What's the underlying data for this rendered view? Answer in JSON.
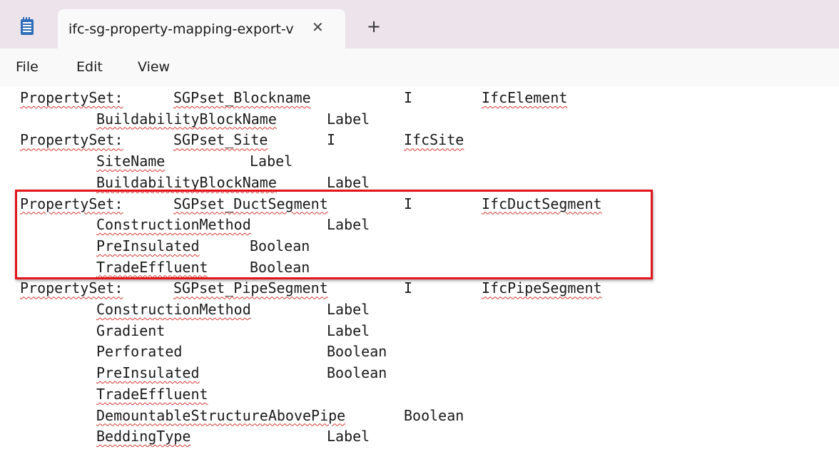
{
  "tab": {
    "title": "ifc-sg-property-mapping-export-v",
    "close_glyph": "✕",
    "new_tab_glyph": "+",
    "icon": "notepad-icon"
  },
  "menu": [
    "File",
    "Edit",
    "View"
  ],
  "document": {
    "lines": [
      [
        "PropertySet:",
        "SGPset_Blockname",
        "I",
        "IfcElement"
      ],
      [
        "BuildabilityBlockName",
        "Label"
      ],
      [
        "PropertySet:",
        "SGPset_Site",
        "I",
        "IfcSite"
      ],
      [
        "SiteName",
        "Label"
      ],
      [
        "BuildabilityBlockName",
        "Label"
      ],
      [
        "PropertySet:",
        "SGPset_DuctSegment",
        "I",
        "IfcDuctSegment"
      ],
      [
        "ConstructionMethod",
        "Label"
      ],
      [
        "PreInsulated",
        "Boolean"
      ],
      [
        "TradeEffluent",
        "Boolean"
      ],
      [
        "PropertySet:",
        "SGPset_PipeSegment",
        "I",
        "IfcPipeSegment"
      ],
      [
        "ConstructionMethod",
        "Label"
      ],
      [
        "Gradient",
        "Label"
      ],
      [
        "Perforated",
        "Boolean"
      ],
      [
        "PreInsulated",
        "Boolean"
      ],
      [
        "TradeEffluent"
      ],
      [
        "DemountableStructureAbovePipe",
        "Boolean"
      ],
      [
        "BeddingType",
        "Label"
      ]
    ]
  },
  "annotation": {
    "highlight_color": "#e2141c",
    "highlighted_property_set": "SGPset_DuctSegment"
  }
}
